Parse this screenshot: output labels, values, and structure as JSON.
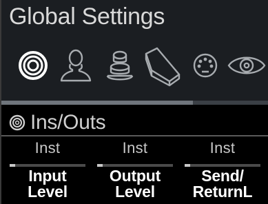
{
  "header": {
    "title": "Global Settings",
    "tabs": [
      {
        "icon": "ins-outs-icon",
        "active": true
      },
      {
        "icon": "preferences-person-icon",
        "active": false
      },
      {
        "icon": "stack-knob-icon",
        "active": false
      },
      {
        "icon": "footswitch-pedal-icon",
        "active": false
      },
      {
        "icon": "midi-icon",
        "active": false
      },
      {
        "icon": "display-eye-icon",
        "active": false
      }
    ]
  },
  "section": {
    "title": "Ins/Outs",
    "icon": "ins-outs-icon",
    "columns": [
      {
        "value": "Inst",
        "label_line1": "Input",
        "label_line2": "Level",
        "level": 0.07
      },
      {
        "value": "Inst",
        "label_line1": "Output",
        "label_line2": "Level",
        "level": 0.07
      },
      {
        "value": "Inst",
        "label_line1": "Send/",
        "label_line2": "ReturnL",
        "level": 0.07
      }
    ]
  },
  "colors": {
    "header_bg": "#1b1e22",
    "background": "#000000",
    "text": "#e8e8e8",
    "accent_line": "#6f757c"
  }
}
